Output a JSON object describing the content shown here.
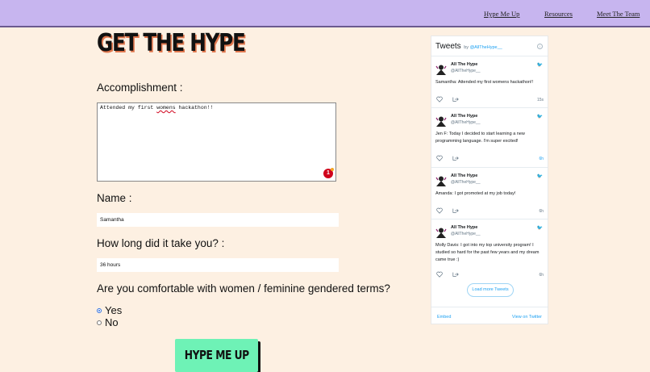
{
  "nav": {
    "items": [
      "Hype Me Up",
      "Resources",
      "Meet The Team"
    ]
  },
  "page": {
    "title": "GET THE HYPE"
  },
  "form": {
    "accomplishment_label": "Accomplishment :",
    "accomplishment_before": "Attended my first ",
    "accomplishment_misspelled": "womens",
    "accomplishment_after": " hackathon!!",
    "grammar_badge_count": "1",
    "name_label": "Name :",
    "name_value": "Samantha",
    "time_label": "How long did it take you? :",
    "time_value": "36 hours",
    "comfort_label": "Are you comfortable with women / feminine gendered terms?",
    "options": [
      {
        "label": "Yes",
        "checked": true
      },
      {
        "label": "No",
        "checked": false
      }
    ],
    "submit_label": "HYPE ME UP"
  },
  "colors": {
    "background": "#fdf0e2",
    "navbar": "#c7b5ef",
    "button": "#6ef2b6",
    "title_shadow": "#e0774e",
    "twitter_blue": "#1da1f2"
  },
  "twitter": {
    "title": "Tweets",
    "by": "by",
    "handle": "@AllTheHype__",
    "tweets": [
      {
        "author": "All The Hype",
        "handle": "@AllTheHype__",
        "text": "Samantha:  Attended my first womens hackathon!!",
        "time": "15s"
      },
      {
        "author": "All The Hype",
        "handle": "@AllTheHype__",
        "text": "Jen  F: Today I decided to start learning a new programming language. I'm super excited!",
        "time": "6h"
      },
      {
        "author": "All The Hype",
        "handle": "@AllTheHype__",
        "text": "Amanda: I got promoted at my job today!",
        "time": "6h"
      },
      {
        "author": "All The Hype",
        "handle": "@AllTheHype__",
        "text": "Molly Davis: I got into my top university program! I studied so hard for the past few years and my dream came true :)",
        "time": "6h"
      }
    ],
    "load_more": "Load more Tweets",
    "embed": "Embed",
    "view_on_twitter": "View on Twitter"
  }
}
